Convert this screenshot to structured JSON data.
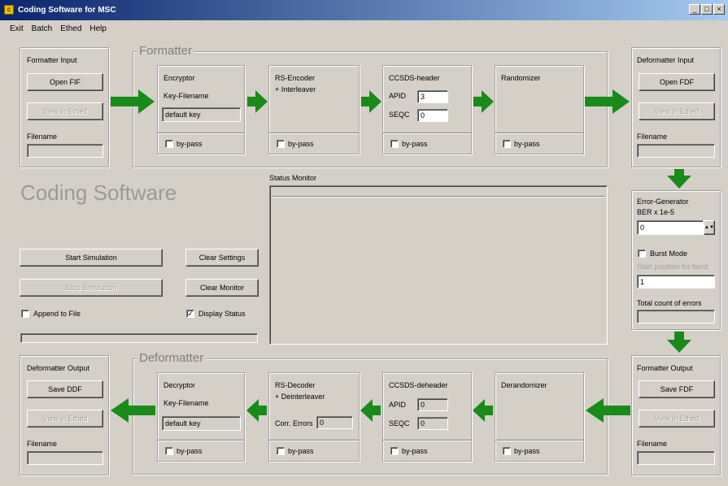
{
  "window": {
    "title": "Coding Software for MSC"
  },
  "menu": [
    "Exit",
    "Batch",
    "Ethed",
    "Help"
  ],
  "formatter_input": {
    "title": "Formatter Input",
    "open_btn": "Open FIF",
    "view_btn": "View in Ethed",
    "filename_label": "Filename"
  },
  "formatter": {
    "title": "Formatter"
  },
  "encryptor": {
    "title": "Encryptor",
    "key_label": "Key-Filename",
    "key_value": "default key",
    "bypass": "by-pass"
  },
  "rs_encoder": {
    "title": "RS-Encoder",
    "subtitle": "+ Interleaver",
    "bypass": "by-pass"
  },
  "ccsds_header": {
    "title": "CCSDS-header",
    "apid_label": "APID",
    "apid_value": "3",
    "seqc_label": "SEQC",
    "seqc_value": "0",
    "bypass": "by-pass"
  },
  "randomizer": {
    "title": "Randomizer",
    "bypass": "by-pass"
  },
  "deformatter_input": {
    "title": "Deformatter Input",
    "open_btn": "Open FDF",
    "view_btn": "View in Ethed",
    "filename_label": "Filename"
  },
  "main": {
    "app_title": "Coding Software",
    "status_label": "Status Monitor",
    "start_btn": "Start Simulation",
    "stop_btn": "Stop Simulation",
    "clear_settings_btn": "Clear Settings",
    "clear_monitor_btn": "Clear Monitor",
    "append_label": "Append to File",
    "display_status_label": "Display Status",
    "display_status_check": "✓"
  },
  "error_gen": {
    "title": "Error-Generator",
    "ber_label": "BER x 1e-5",
    "ber_value": "0",
    "burst_label": "Burst Mode",
    "burst_pos_label": "Start position for burst",
    "burst_pos_value": "1",
    "total_label": "Total count of errors"
  },
  "formatter_output": {
    "title": "Formatter Output",
    "save_btn": "Save FDF",
    "view_btn": "View in Ethed",
    "filename_label": "Filename"
  },
  "deformatter": {
    "title": "Deformatter"
  },
  "decryptor": {
    "title": "Decryptor",
    "key_label": "Key-Filename",
    "key_value": "default key",
    "bypass": "by-pass"
  },
  "rs_decoder": {
    "title": "RS-Decoder",
    "subtitle": "+ Deinterleaver",
    "corr_label": "Corr. Errors",
    "corr_value": "0",
    "bypass": "by-pass"
  },
  "ccsds_deheader": {
    "title": "CCSDS-deheader",
    "apid_label": "APID",
    "apid_value": "0",
    "seqc_label": "SEQC",
    "seqc_value": "0",
    "bypass": "by-pass"
  },
  "derandomizer": {
    "title": "Derandomizer",
    "bypass": "by-pass"
  },
  "deformatter_output": {
    "title": "Deformatter Output",
    "save_btn": "Save DDF",
    "view_btn": "View in Ethed",
    "filename_label": "Filename"
  },
  "colors": {
    "arrow": "#1a8a1a",
    "titlebar": "#0a246a"
  }
}
